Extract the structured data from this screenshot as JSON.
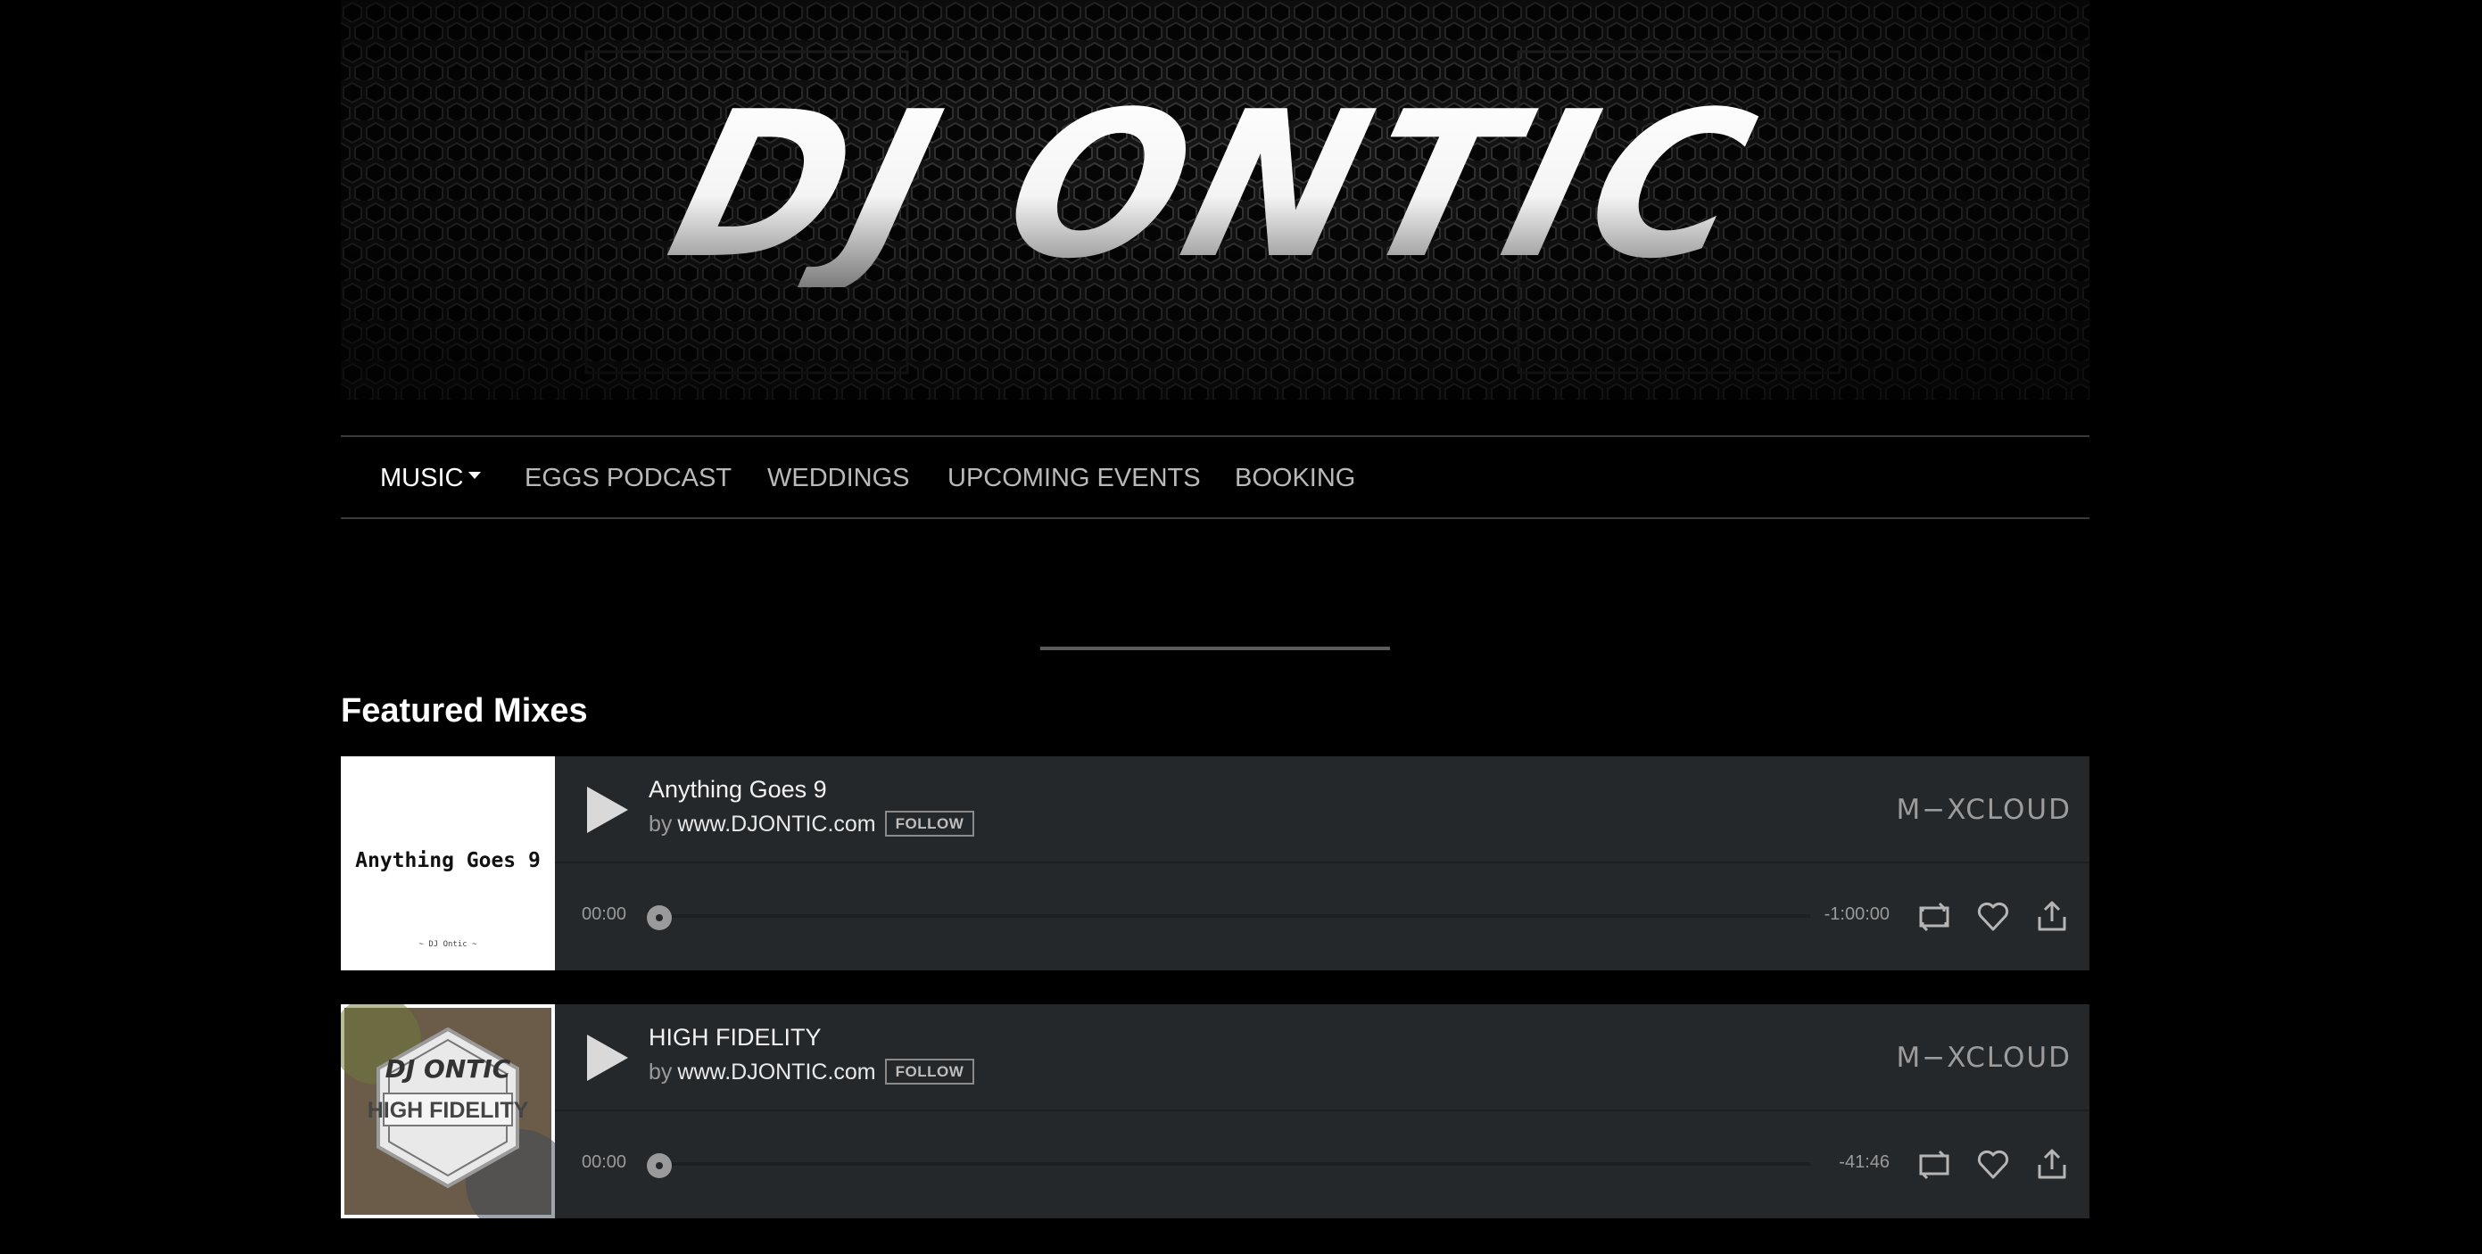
{
  "header": {
    "logo_text": "DJ ONTIC"
  },
  "nav": {
    "items": [
      {
        "label": "MUSIC",
        "active": true,
        "has_dropdown": true
      },
      {
        "label": "EGGS PODCAST"
      },
      {
        "label": "WEDDINGS"
      },
      {
        "label": "UPCOMING EVENTS"
      },
      {
        "label": "BOOKING"
      }
    ]
  },
  "featured": {
    "title": "Featured Mixes",
    "mixes": [
      {
        "title": "Anything Goes 9",
        "by_prefix": "by",
        "author": "www.DJONTIC.com",
        "follow_label": "FOLLOW",
        "brand": "M−XCLOUD",
        "time_current": "00:00",
        "time_remaining": "-1:00:00",
        "progress": 0,
        "cover": {
          "style": "white",
          "title": "Anything Goes 9",
          "subtitle": "~ DJ Ontic ~"
        },
        "icons": [
          "play-icon",
          "repost-icon",
          "heart-icon",
          "share-icon"
        ]
      },
      {
        "title": "HIGH FIDELITY",
        "by_prefix": "by",
        "author": "www.DJONTIC.com",
        "follow_label": "FOLLOW",
        "brand": "M−XCLOUD",
        "time_current": "00:00",
        "time_remaining": "-41:46",
        "progress": 0,
        "cover": {
          "style": "badge",
          "badge_top": "DJ ONTIC",
          "badge_main": "HIGH FIDELITY"
        },
        "icons": [
          "play-icon",
          "repost-icon",
          "heart-icon",
          "share-icon"
        ]
      }
    ]
  },
  "colors": {
    "background": "#000000",
    "player_bg": "#25282b",
    "nav_inactive": "#b9b9b9",
    "nav_active": "#ffffff",
    "muted": "#9a9a9a"
  }
}
